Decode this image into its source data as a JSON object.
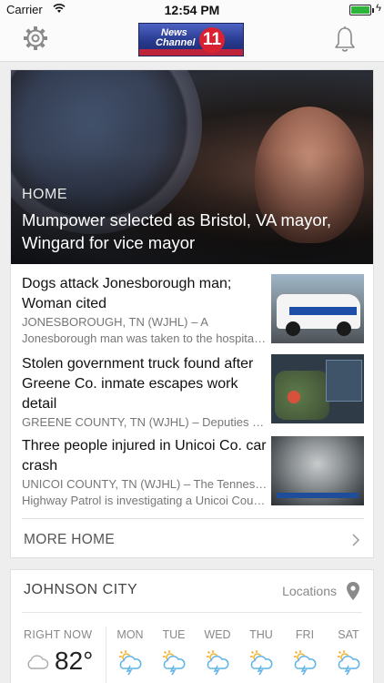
{
  "status_bar": {
    "carrier": "Carrier",
    "time": "12:54 PM"
  },
  "header": {
    "logo_line1": "News",
    "logo_line2": "Channel",
    "logo_number": "11"
  },
  "news": {
    "hero": {
      "section": "HOME",
      "headline": "Mumpower selected as Bristol, VA mayor, Wingard for vice mayor"
    },
    "stories": [
      {
        "title": "Dogs attack Jonesborough man; Woman cited",
        "snippet_line1": "JONESBOROUGH, TN (WJHL) – A",
        "snippet_line2": "Jonesborough man was taken to the hospital…"
      },
      {
        "title": "Stolen government truck found after Greene Co. inmate escapes work detail",
        "snippet_line1": "GREENE COUNTY, TN (WJHL) – Deputies say…",
        "snippet_line2": ""
      },
      {
        "title": "Three people injured in Unicoi Co. car crash",
        "snippet_line1": "UNICOI COUNTY, TN (WJHL) – The Tennessee",
        "snippet_line2": "Highway Patrol is investigating a Unicoi Coun…"
      }
    ],
    "more_label": "MORE HOME"
  },
  "weather": {
    "city": "JOHNSON CITY",
    "locations_label": "Locations",
    "now_label": "RIGHT NOW",
    "current_temp": "82°",
    "days": [
      "MON",
      "TUE",
      "WED",
      "THU",
      "FRI",
      "SAT"
    ]
  },
  "colors": {
    "accent": "#d92231",
    "brand_blue": "#283a8f"
  }
}
